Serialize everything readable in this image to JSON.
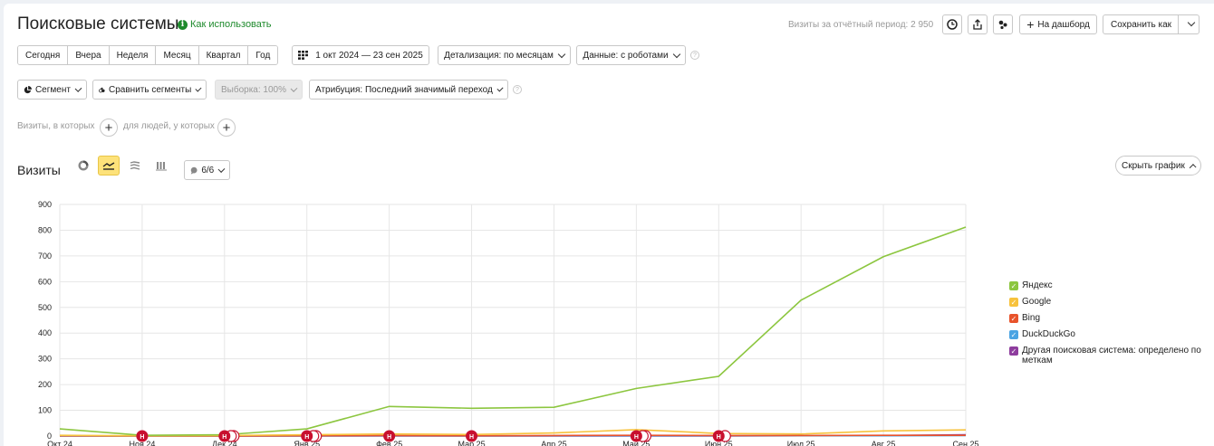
{
  "header": {
    "title": "Поисковые системы",
    "howto_label": "Как использовать",
    "visits_period": "Визиты за отчётный период: 2 950",
    "to_dashboard_label": "На дашборд",
    "save_as_label": "Сохранить как"
  },
  "period_buttons": [
    "Сегодня",
    "Вчера",
    "Неделя",
    "Месяц",
    "Квартал",
    "Год"
  ],
  "date_range": "1 окт 2024 — 23 сен 2025",
  "detail_label": "Детализация: по месяцам",
  "data_label": "Данные: с роботами",
  "segment_label": "Сегмент",
  "compare_label": "Сравнить сегменты",
  "sample_label": "Выборка: 100%",
  "attribution_label": "Атрибуция: Последний значимый переход",
  "conditions": {
    "visits_label": "Визиты, в которых",
    "people_label": "для людей, у которых"
  },
  "chart_header": {
    "title": "Визиты",
    "series_count": "6/6",
    "hide_chart_label": "Скрыть график"
  },
  "legend": [
    {
      "label": "Яндекс",
      "color": "#8cc63f"
    },
    {
      "label": "Google",
      "color": "#f7c23c"
    },
    {
      "label": "Bing",
      "color": "#e8532b"
    },
    {
      "label": "DuckDuckGo",
      "color": "#4ba4e3"
    },
    {
      "label": "Другая поисковая система: определено по меткам",
      "color": "#8e3d9e"
    }
  ],
  "chart_data": {
    "type": "line",
    "categories": [
      "Окт 24",
      "Ноя 24",
      "Дек 24",
      "Янв 25",
      "Фев 25",
      "Мар 25",
      "Апр 25",
      "Май 25",
      "Июн 25",
      "Июл 25",
      "Авг 25",
      "Сен 25"
    ],
    "ylim": [
      0,
      900
    ],
    "yticks": [
      0,
      100,
      200,
      300,
      400,
      500,
      600,
      700,
      800,
      900
    ],
    "grid": true,
    "legend_position": "right",
    "series": [
      {
        "name": "Яндекс",
        "color": "#8cc63f",
        "values": [
          28,
          3,
          5,
          28,
          115,
          108,
          112,
          185,
          232,
          528,
          697,
          812
        ]
      },
      {
        "name": "Google",
        "color": "#f7c23c",
        "values": [
          3,
          1,
          2,
          5,
          8,
          6,
          12,
          25,
          10,
          8,
          20,
          24
        ]
      },
      {
        "name": "Bing",
        "color": "#e8532b",
        "values": [
          1,
          0,
          0,
          1,
          2,
          1,
          2,
          3,
          2,
          2,
          3,
          3
        ]
      },
      {
        "name": "DuckDuckGo",
        "color": "#4ba4e3",
        "values": [
          0,
          0,
          0,
          0,
          1,
          0,
          1,
          1,
          1,
          1,
          1,
          2
        ]
      },
      {
        "name": "Другая поисковая система: определено по меткам",
        "color": "#8e3d9e",
        "values": [
          0,
          0,
          0,
          0,
          0,
          0,
          0,
          0,
          0,
          1,
          2,
          5
        ]
      }
    ],
    "annotations": [
      {
        "category": "Ноя 24",
        "count": 1
      },
      {
        "category": "Дек 24",
        "count": 3
      },
      {
        "category": "Янв 25",
        "count": 3
      },
      {
        "category": "Фев 25",
        "count": 1
      },
      {
        "category": "Мар 25",
        "count": 1
      },
      {
        "category": "Май 25",
        "count": 3
      },
      {
        "category": "Июн 25",
        "count": 2
      }
    ],
    "annotation_marker": "Н"
  }
}
